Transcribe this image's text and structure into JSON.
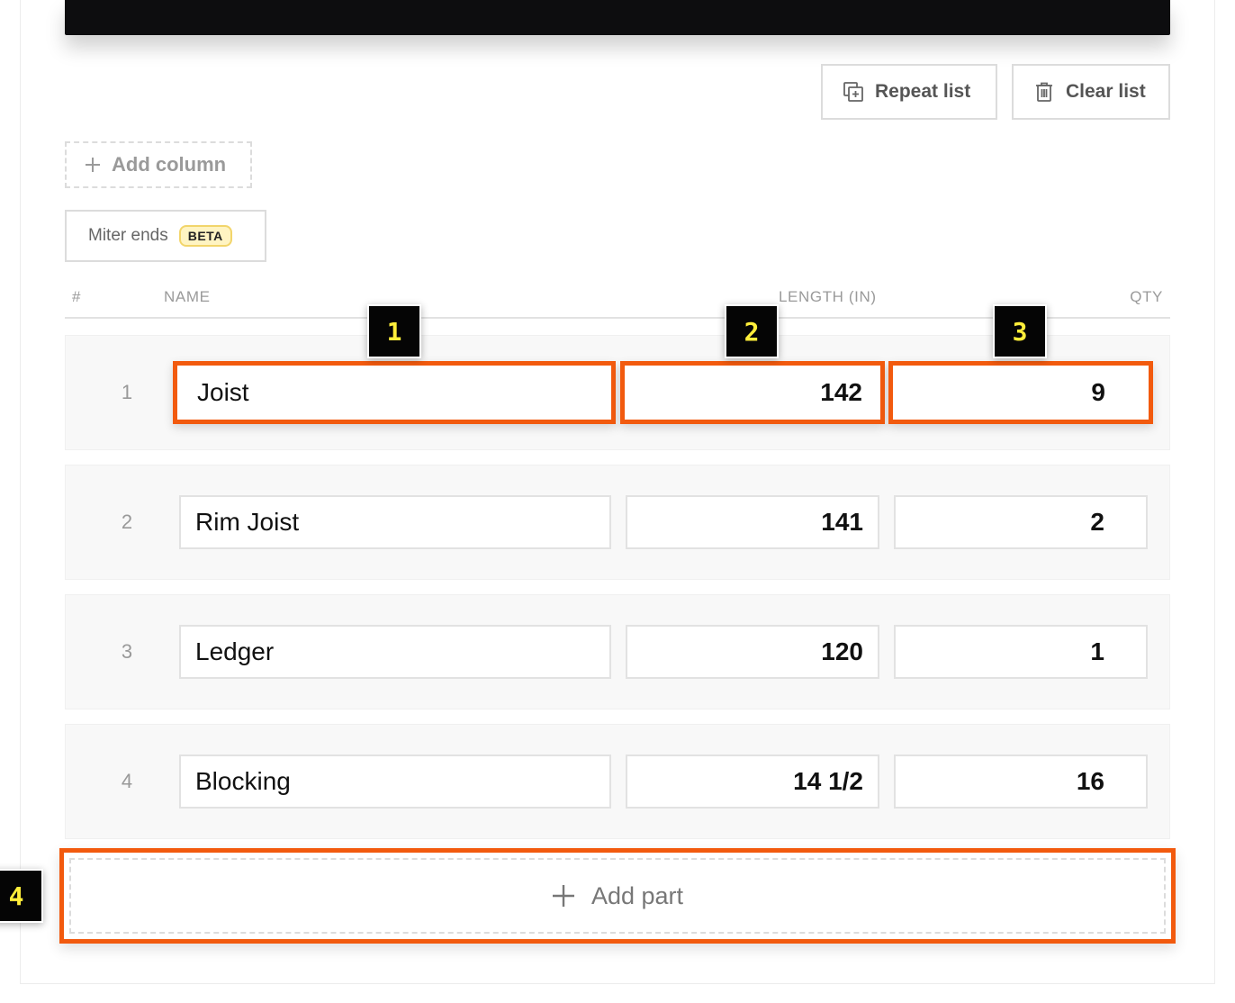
{
  "toolbar": {
    "repeat_label": "Repeat list",
    "clear_label": "Clear list",
    "add_column_label": "Add column",
    "miter_label": "Miter ends",
    "beta_label": "BETA"
  },
  "table": {
    "headers": {
      "num": "#",
      "name": "NAME",
      "length": "LENGTH (IN)",
      "qty": "QTY"
    },
    "rows": [
      {
        "num": "1",
        "name": "Joist",
        "length": "142",
        "qty": "9"
      },
      {
        "num": "2",
        "name": "Rim Joist",
        "length": "141",
        "qty": "2"
      },
      {
        "num": "3",
        "name": "Ledger",
        "length": "120",
        "qty": "1"
      },
      {
        "num": "4",
        "name": "Blocking",
        "length": "14 1/2",
        "qty": "16"
      }
    ]
  },
  "add_part_label": "Add part",
  "markers": [
    "1",
    "2",
    "3",
    "4"
  ],
  "colors": {
    "highlight": "#f25a0e",
    "marker_text": "#ffee3a",
    "beta_bg": "#fff4c2"
  }
}
